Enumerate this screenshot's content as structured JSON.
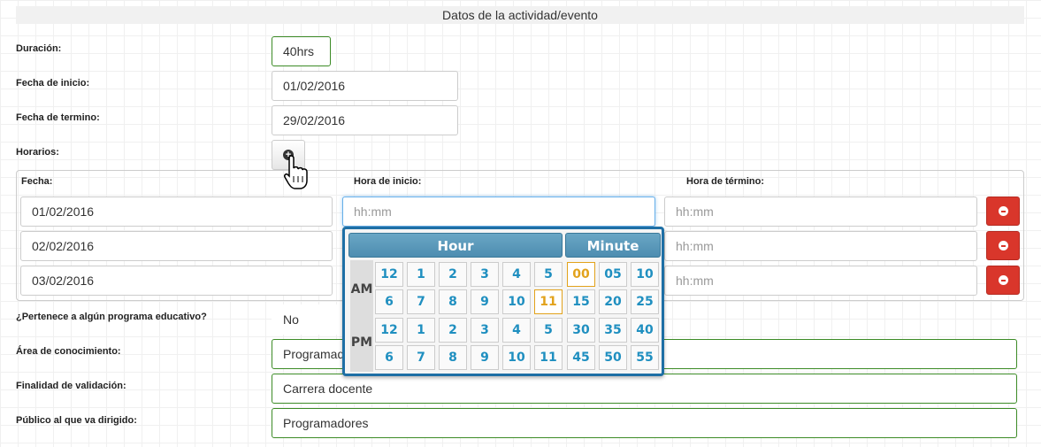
{
  "section_title": "Datos de la actividad/evento",
  "form": {
    "duracion": {
      "label": "Duración:",
      "value": "40hrs"
    },
    "fecha_inicio": {
      "label": "Fecha de inicio:",
      "value": "01/02/2016"
    },
    "fecha_termino": {
      "label": "Fecha de termino:",
      "value": "29/02/2016"
    },
    "horarios": {
      "label": "Horarios:",
      "add_icon": "plus-circle-icon"
    },
    "programa": {
      "label": "¿Pertenece a algún programa educativo?",
      "value": "No"
    },
    "area": {
      "label": "Área de conocimiento:",
      "value": "Programadores"
    },
    "finalidad": {
      "label": "Finalidad de validación:",
      "value": "Carrera docente"
    },
    "publico": {
      "label": "Público al que va dirigido:",
      "value": "Programadores"
    }
  },
  "schedule": {
    "headers": {
      "fecha": "Fecha:",
      "hora_inicio": "Hora de inicio:",
      "hora_termino": "Hora de término:"
    },
    "placeholder": "hh:mm",
    "rows": [
      {
        "fecha": "01/02/2016"
      },
      {
        "fecha": "02/02/2016"
      },
      {
        "fecha": "03/02/2016"
      }
    ],
    "delete_icon": "minus-circle-icon"
  },
  "timepicker": {
    "hour_title": "Hour",
    "minute_title": "Minute",
    "am_label": "AM",
    "pm_label": "PM",
    "am_hours": [
      [
        "12",
        "1",
        "2",
        "3",
        "4",
        "5"
      ],
      [
        "6",
        "7",
        "8",
        "9",
        "10",
        "11"
      ]
    ],
    "pm_hours": [
      [
        "12",
        "1",
        "2",
        "3",
        "4",
        "5"
      ],
      [
        "6",
        "7",
        "8",
        "9",
        "10",
        "11"
      ]
    ],
    "minutes": [
      [
        "00",
        "05",
        "10"
      ],
      [
        "15",
        "20",
        "25"
      ],
      [
        "30",
        "35",
        "40"
      ],
      [
        "45",
        "50",
        "55"
      ]
    ],
    "selected_hour": "11",
    "selected_minute": "00",
    "accent_color": "#1f8fc0",
    "selected_color": "#e2a21b"
  }
}
